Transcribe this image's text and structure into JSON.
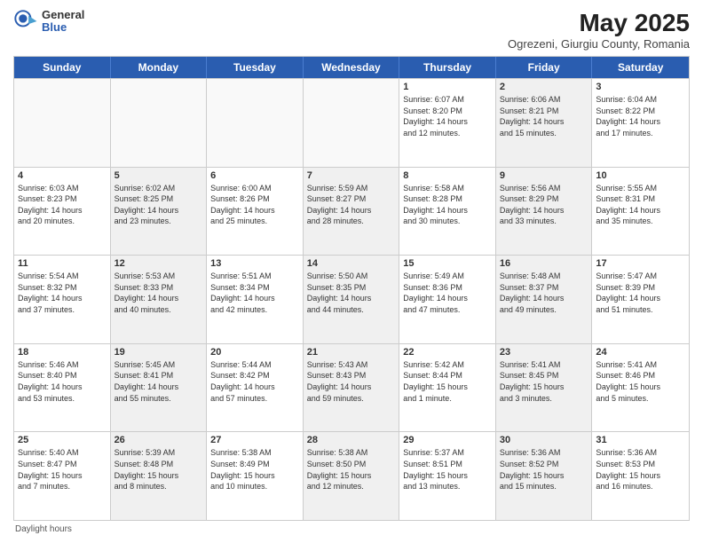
{
  "header": {
    "logo_general": "General",
    "logo_blue": "Blue",
    "month_title": "May 2025",
    "location": "Ogrezeni, Giurgiu County, Romania"
  },
  "days_of_week": [
    "Sunday",
    "Monday",
    "Tuesday",
    "Wednesday",
    "Thursday",
    "Friday",
    "Saturday"
  ],
  "rows": [
    [
      {
        "day": "",
        "info": "",
        "shaded": false,
        "empty": true
      },
      {
        "day": "",
        "info": "",
        "shaded": false,
        "empty": true
      },
      {
        "day": "",
        "info": "",
        "shaded": false,
        "empty": true
      },
      {
        "day": "",
        "info": "",
        "shaded": false,
        "empty": true
      },
      {
        "day": "1",
        "info": "Sunrise: 6:07 AM\nSunset: 8:20 PM\nDaylight: 14 hours\nand 12 minutes.",
        "shaded": false,
        "empty": false
      },
      {
        "day": "2",
        "info": "Sunrise: 6:06 AM\nSunset: 8:21 PM\nDaylight: 14 hours\nand 15 minutes.",
        "shaded": true,
        "empty": false
      },
      {
        "day": "3",
        "info": "Sunrise: 6:04 AM\nSunset: 8:22 PM\nDaylight: 14 hours\nand 17 minutes.",
        "shaded": false,
        "empty": false
      }
    ],
    [
      {
        "day": "4",
        "info": "Sunrise: 6:03 AM\nSunset: 8:23 PM\nDaylight: 14 hours\nand 20 minutes.",
        "shaded": false,
        "empty": false
      },
      {
        "day": "5",
        "info": "Sunrise: 6:02 AM\nSunset: 8:25 PM\nDaylight: 14 hours\nand 23 minutes.",
        "shaded": true,
        "empty": false
      },
      {
        "day": "6",
        "info": "Sunrise: 6:00 AM\nSunset: 8:26 PM\nDaylight: 14 hours\nand 25 minutes.",
        "shaded": false,
        "empty": false
      },
      {
        "day": "7",
        "info": "Sunrise: 5:59 AM\nSunset: 8:27 PM\nDaylight: 14 hours\nand 28 minutes.",
        "shaded": true,
        "empty": false
      },
      {
        "day": "8",
        "info": "Sunrise: 5:58 AM\nSunset: 8:28 PM\nDaylight: 14 hours\nand 30 minutes.",
        "shaded": false,
        "empty": false
      },
      {
        "day": "9",
        "info": "Sunrise: 5:56 AM\nSunset: 8:29 PM\nDaylight: 14 hours\nand 33 minutes.",
        "shaded": true,
        "empty": false
      },
      {
        "day": "10",
        "info": "Sunrise: 5:55 AM\nSunset: 8:31 PM\nDaylight: 14 hours\nand 35 minutes.",
        "shaded": false,
        "empty": false
      }
    ],
    [
      {
        "day": "11",
        "info": "Sunrise: 5:54 AM\nSunset: 8:32 PM\nDaylight: 14 hours\nand 37 minutes.",
        "shaded": false,
        "empty": false
      },
      {
        "day": "12",
        "info": "Sunrise: 5:53 AM\nSunset: 8:33 PM\nDaylight: 14 hours\nand 40 minutes.",
        "shaded": true,
        "empty": false
      },
      {
        "day": "13",
        "info": "Sunrise: 5:51 AM\nSunset: 8:34 PM\nDaylight: 14 hours\nand 42 minutes.",
        "shaded": false,
        "empty": false
      },
      {
        "day": "14",
        "info": "Sunrise: 5:50 AM\nSunset: 8:35 PM\nDaylight: 14 hours\nand 44 minutes.",
        "shaded": true,
        "empty": false
      },
      {
        "day": "15",
        "info": "Sunrise: 5:49 AM\nSunset: 8:36 PM\nDaylight: 14 hours\nand 47 minutes.",
        "shaded": false,
        "empty": false
      },
      {
        "day": "16",
        "info": "Sunrise: 5:48 AM\nSunset: 8:37 PM\nDaylight: 14 hours\nand 49 minutes.",
        "shaded": true,
        "empty": false
      },
      {
        "day": "17",
        "info": "Sunrise: 5:47 AM\nSunset: 8:39 PM\nDaylight: 14 hours\nand 51 minutes.",
        "shaded": false,
        "empty": false
      }
    ],
    [
      {
        "day": "18",
        "info": "Sunrise: 5:46 AM\nSunset: 8:40 PM\nDaylight: 14 hours\nand 53 minutes.",
        "shaded": false,
        "empty": false
      },
      {
        "day": "19",
        "info": "Sunrise: 5:45 AM\nSunset: 8:41 PM\nDaylight: 14 hours\nand 55 minutes.",
        "shaded": true,
        "empty": false
      },
      {
        "day": "20",
        "info": "Sunrise: 5:44 AM\nSunset: 8:42 PM\nDaylight: 14 hours\nand 57 minutes.",
        "shaded": false,
        "empty": false
      },
      {
        "day": "21",
        "info": "Sunrise: 5:43 AM\nSunset: 8:43 PM\nDaylight: 14 hours\nand 59 minutes.",
        "shaded": true,
        "empty": false
      },
      {
        "day": "22",
        "info": "Sunrise: 5:42 AM\nSunset: 8:44 PM\nDaylight: 15 hours\nand 1 minute.",
        "shaded": false,
        "empty": false
      },
      {
        "day": "23",
        "info": "Sunrise: 5:41 AM\nSunset: 8:45 PM\nDaylight: 15 hours\nand 3 minutes.",
        "shaded": true,
        "empty": false
      },
      {
        "day": "24",
        "info": "Sunrise: 5:41 AM\nSunset: 8:46 PM\nDaylight: 15 hours\nand 5 minutes.",
        "shaded": false,
        "empty": false
      }
    ],
    [
      {
        "day": "25",
        "info": "Sunrise: 5:40 AM\nSunset: 8:47 PM\nDaylight: 15 hours\nand 7 minutes.",
        "shaded": false,
        "empty": false
      },
      {
        "day": "26",
        "info": "Sunrise: 5:39 AM\nSunset: 8:48 PM\nDaylight: 15 hours\nand 8 minutes.",
        "shaded": true,
        "empty": false
      },
      {
        "day": "27",
        "info": "Sunrise: 5:38 AM\nSunset: 8:49 PM\nDaylight: 15 hours\nand 10 minutes.",
        "shaded": false,
        "empty": false
      },
      {
        "day": "28",
        "info": "Sunrise: 5:38 AM\nSunset: 8:50 PM\nDaylight: 15 hours\nand 12 minutes.",
        "shaded": true,
        "empty": false
      },
      {
        "day": "29",
        "info": "Sunrise: 5:37 AM\nSunset: 8:51 PM\nDaylight: 15 hours\nand 13 minutes.",
        "shaded": false,
        "empty": false
      },
      {
        "day": "30",
        "info": "Sunrise: 5:36 AM\nSunset: 8:52 PM\nDaylight: 15 hours\nand 15 minutes.",
        "shaded": true,
        "empty": false
      },
      {
        "day": "31",
        "info": "Sunrise: 5:36 AM\nSunset: 8:53 PM\nDaylight: 15 hours\nand 16 minutes.",
        "shaded": false,
        "empty": false
      }
    ]
  ],
  "footer": "Daylight hours"
}
